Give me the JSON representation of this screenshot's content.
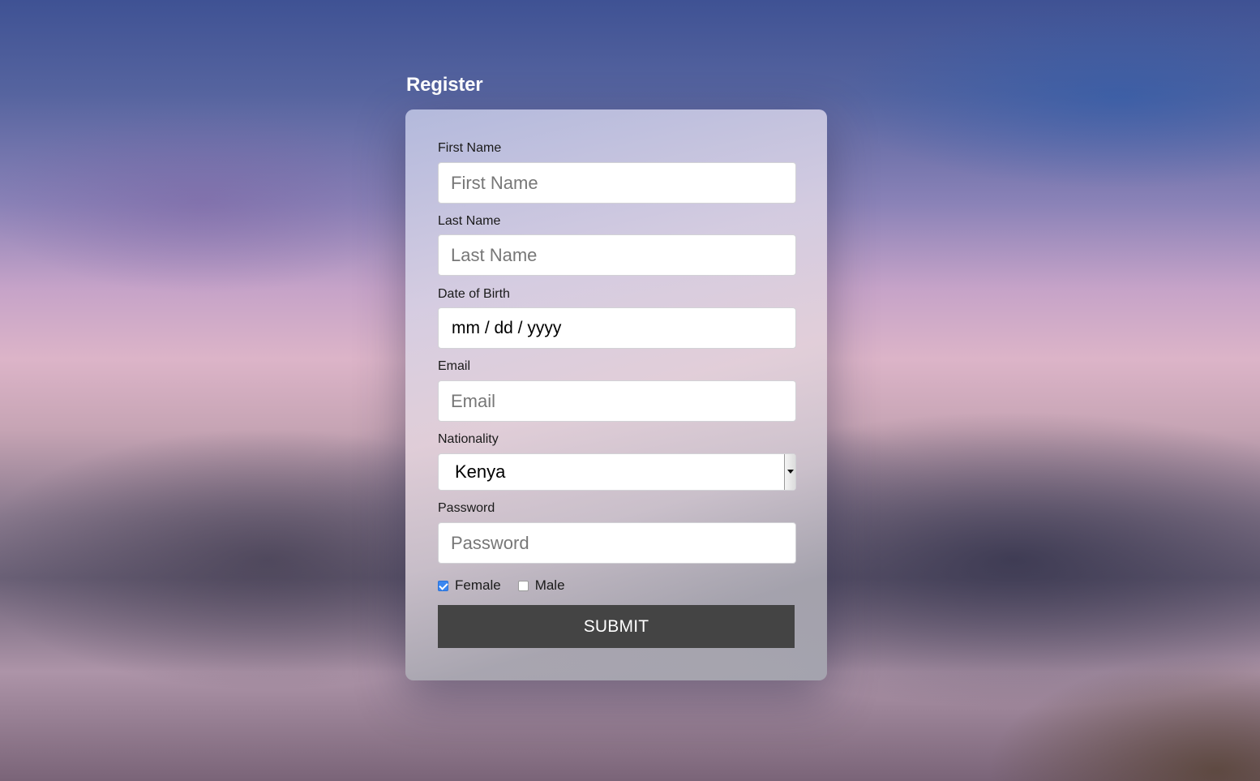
{
  "page": {
    "title": "Register"
  },
  "form": {
    "first_name": {
      "label": "First Name",
      "placeholder": "First Name",
      "value": ""
    },
    "last_name": {
      "label": "Last Name",
      "placeholder": "Last Name",
      "value": ""
    },
    "dob": {
      "label": "Date of Birth",
      "display": "mm / dd / yyyy"
    },
    "email": {
      "label": "Email",
      "placeholder": "Email",
      "value": ""
    },
    "nationality": {
      "label": "Nationality",
      "selected": "Kenya"
    },
    "password": {
      "label": "Password",
      "placeholder": "Password",
      "value": ""
    },
    "gender": {
      "options": [
        {
          "label": "Female",
          "checked": true
        },
        {
          "label": "Male",
          "checked": false
        }
      ]
    },
    "submit_label": "SUBMIT"
  },
  "colors": {
    "submit_bg": "#444444",
    "checkbox_accent": "#3b87f0",
    "title_text": "#ffffff"
  },
  "icons": {
    "select_arrow": "chevron-down-icon",
    "checkmark": "checkmark-icon"
  }
}
